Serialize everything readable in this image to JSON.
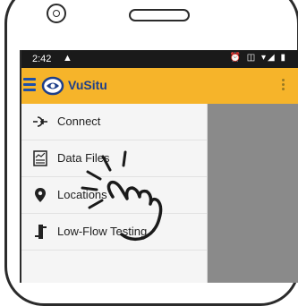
{
  "status_bar": {
    "time": "2:42",
    "warning_icon": "warning-icon",
    "right_icons": [
      "alarm-icon",
      "vibrate-icon",
      "wifi-icon",
      "signal-icon",
      "battery-icon"
    ],
    "right_glyphs": "⏰ ◫ ▾◢ ▮"
  },
  "app_bar": {
    "title": "VuSitu",
    "menu_icon": "hamburger-menu-icon",
    "logo_icon": "vusitu-logo-icon",
    "overflow_icon": "overflow-menu-icon",
    "colors": {
      "background": "#f6b42a",
      "title": "#1e3f8a",
      "menu": "#1e4fa8"
    }
  },
  "drawer": {
    "items": [
      {
        "label": "Connect",
        "icon": "connect-icon"
      },
      {
        "label": "Data Files",
        "icon": "data-files-icon"
      },
      {
        "label": "Locations",
        "icon": "location-pin-icon"
      },
      {
        "label": "Low-Flow Testing",
        "icon": "low-flow-testing-icon"
      }
    ]
  },
  "overlay": {
    "icon": "tap-gesture-hand-icon"
  }
}
